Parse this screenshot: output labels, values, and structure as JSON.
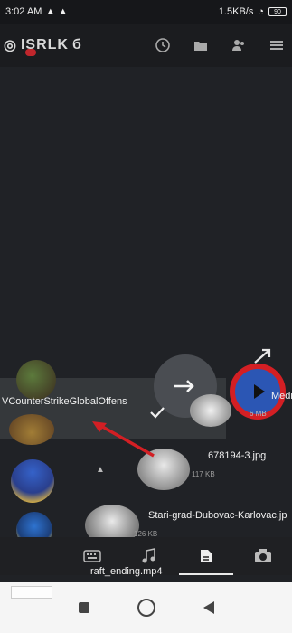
{
  "statusbar": {
    "time": "3:02 AM",
    "speed": "1.5KB/s",
    "battery": "90"
  },
  "appbar": {
    "title": "ISRLK"
  },
  "share_overlay": {
    "media_label": "Medi",
    "media_size": "6 MB"
  },
  "files": [
    {
      "name": "VCounterStrikeGlobalOffens",
      "size": ""
    },
    {
      "name": "678194-3.jpg",
      "size": "117 KB"
    },
    {
      "name": "Stari-grad-Dubovac-Karlovac.jp",
      "size": "126 KB"
    },
    {
      "name": "raft_ending.mp4",
      "size": ""
    }
  ],
  "bottom_nav": {
    "tabs": [
      "keyboard",
      "music",
      "files",
      "camera"
    ],
    "active": "files"
  }
}
